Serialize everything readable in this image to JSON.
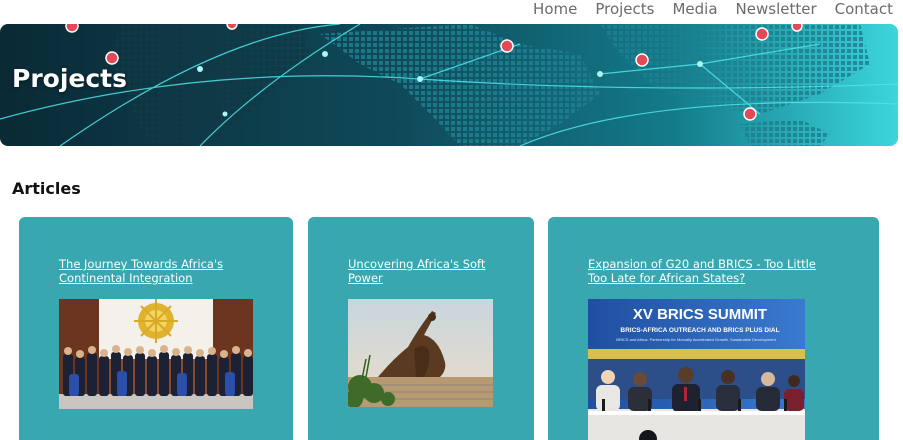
{
  "nav": {
    "items": [
      "Home",
      "Projects",
      "Media",
      "Newsletter",
      "Contact"
    ]
  },
  "banner": {
    "title": "Projects"
  },
  "articles": {
    "heading": "Articles",
    "cards": [
      {
        "title": "The Journey Towards Africa's Continental Integration"
      },
      {
        "title": "Uncovering Africa's Soft Power"
      },
      {
        "title": "Expansion of G20 and BRICS - Too Little Too Late for African States?",
        "image_text": {
          "headline": "XV BRICS SUMMIT",
          "subline": "BRICS-AFRICA OUTREACH AND BRICS PLUS DIAL",
          "tagline": "BRICS and Africa: Partnership for Mutually Accelerated Growth, Sustainable Development"
        }
      }
    ]
  },
  "colors": {
    "card_bg": "#38a7b0",
    "nav_text": "#6b6b6b",
    "banner_dark": "#0a2a35",
    "banner_light": "#3cd6dc"
  }
}
